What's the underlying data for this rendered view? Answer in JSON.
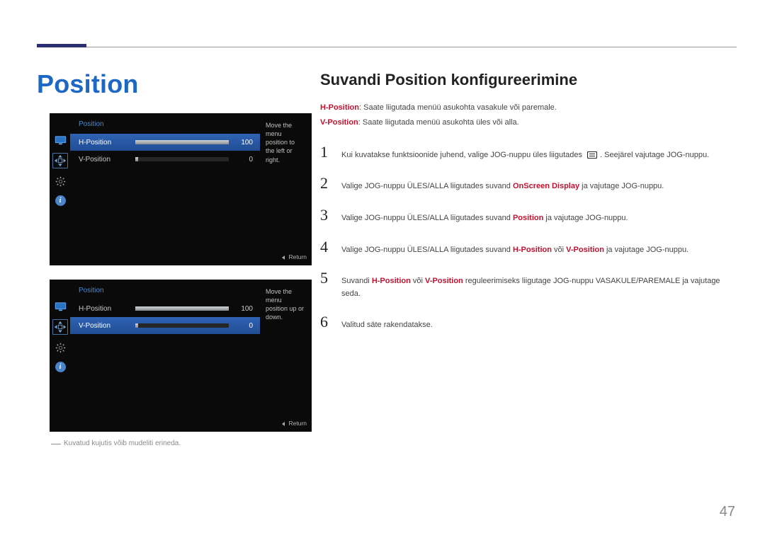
{
  "page": {
    "title": "Position",
    "number": "47"
  },
  "right": {
    "heading": "Suvandi Position konfigureerimine",
    "desc": {
      "hpos_kw": "H-Position",
      "hpos_rest": ": Saate liigutada menüü asukohta vasakule või paremale.",
      "vpos_kw": "V-Position",
      "vpos_rest": ": Saate liigutada menüü asukohta üles või alla."
    },
    "steps": [
      {
        "n": "1",
        "pre": "Kui kuvatakse funktsioonide juhend, valige JOG-nuppu üles liigutades ",
        "post": ". Seejärel vajutage JOG-nuppu."
      },
      {
        "n": "2",
        "pre": "Valige JOG-nuppu ÜLES/ALLA liigutades suvand ",
        "kw1": "OnScreen Display",
        "post": " ja vajutage JOG-nuppu."
      },
      {
        "n": "3",
        "pre": "Valige JOG-nuppu ÜLES/ALLA liigutades suvand ",
        "kw1": "Position",
        "post": " ja vajutage JOG-nuppu."
      },
      {
        "n": "4",
        "pre": "Valige JOG-nuppu ÜLES/ALLA liigutades suvand ",
        "kw1": "H-Position",
        "mid": " või ",
        "kw2": "V-Position",
        "post": " ja vajutage JOG-nuppu."
      },
      {
        "n": "5",
        "pre": "Suvandi ",
        "kw1": "H-Position",
        "mid": " või ",
        "kw2": "V-Position",
        "post": " reguleerimiseks liigutage JOG-nuppu VASAKULE/PAREMALE ja vajutage seda."
      },
      {
        "n": "6",
        "pre": "Valitud säte rakendatakse."
      }
    ]
  },
  "osd1": {
    "header": "Position",
    "help": "Move the menu position to the left or right.",
    "rows": [
      {
        "label": "H-Position",
        "val": "100",
        "sel": true,
        "fill": "full"
      },
      {
        "label": "V-Position",
        "val": "0",
        "sel": false,
        "fill": "partial"
      }
    ],
    "return": "Return"
  },
  "osd2": {
    "header": "Position",
    "help": "Move the menu position up or down.",
    "rows": [
      {
        "label": "H-Position",
        "val": "100",
        "sel": false,
        "fill": "full"
      },
      {
        "label": "V-Position",
        "val": "0",
        "sel": true,
        "fill": "partial"
      }
    ],
    "return": "Return"
  },
  "footnote": "Kuvatud kujutis võib mudeliti erineda.",
  "sidebar_info_glyph": "i"
}
